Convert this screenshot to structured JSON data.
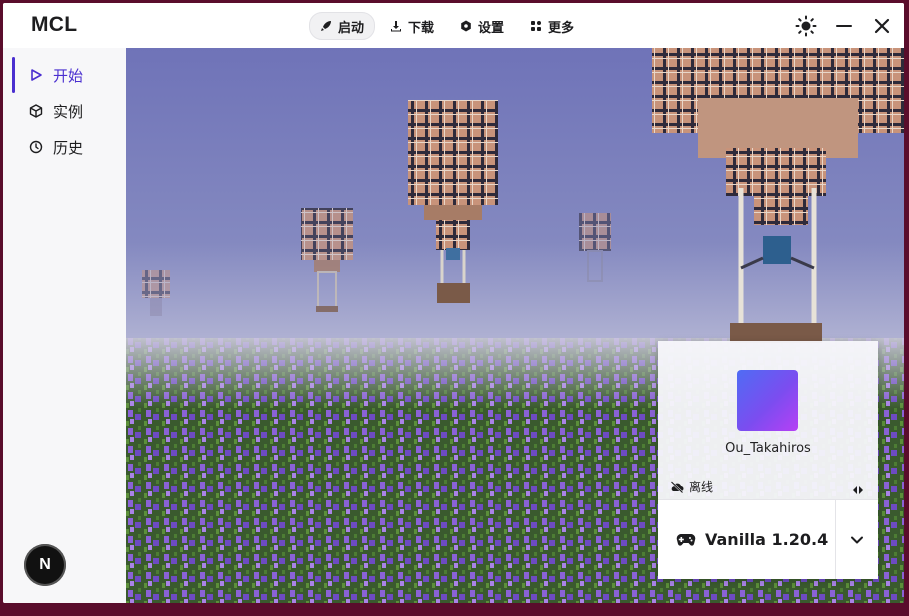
{
  "app": {
    "title": "MCL"
  },
  "nav": {
    "tabs": [
      {
        "label": "启动",
        "icon": "rocket-icon",
        "active": true
      },
      {
        "label": "下载",
        "icon": "download-icon",
        "active": false
      },
      {
        "label": "设置",
        "icon": "gear-icon",
        "active": false
      },
      {
        "label": "更多",
        "icon": "apps-icon",
        "active": false
      }
    ]
  },
  "window_controls": {
    "icons": [
      "sun-icon",
      "minimize-icon",
      "close-icon"
    ]
  },
  "sidebar": {
    "items": [
      {
        "label": "开始",
        "icon": "play-icon",
        "active": true
      },
      {
        "label": "实例",
        "icon": "cube-icon",
        "active": false
      },
      {
        "label": "历史",
        "icon": "history-icon",
        "active": false
      }
    ],
    "badge": "N"
  },
  "account": {
    "username": "Ou_Takahiros",
    "status": "离线",
    "version": "Vanilla 1.20.4"
  },
  "colors": {
    "accent": "#4a2fd0",
    "frame": "#5a0d2c"
  }
}
